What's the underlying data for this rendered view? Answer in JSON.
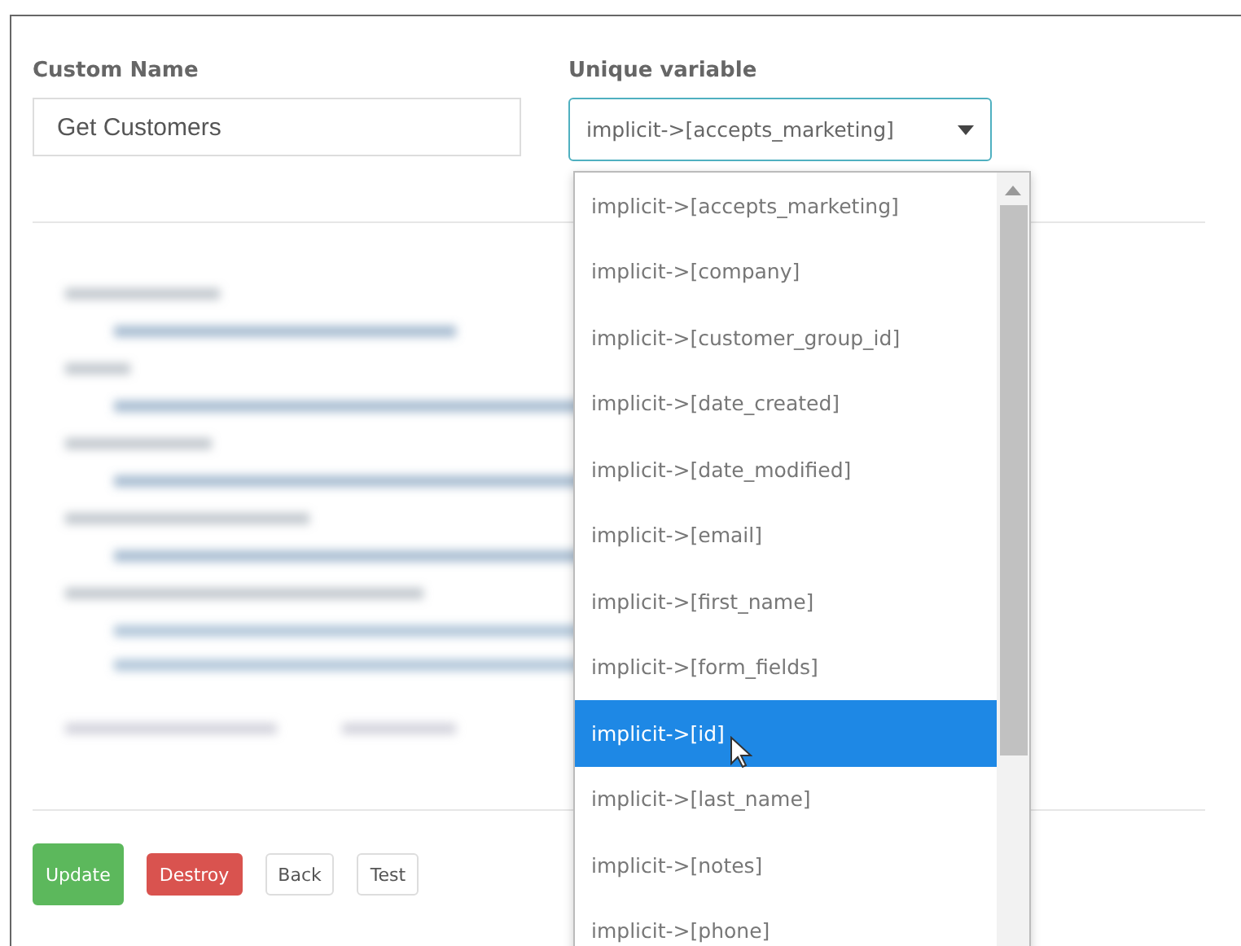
{
  "form": {
    "custom_name": {
      "label": "Custom Name",
      "value": "Get Customers"
    },
    "unique_variable": {
      "label": "Unique variable",
      "value": "implicit->[accepts_marketing]",
      "expanded": true,
      "options": [
        {
          "label": "implicit->[accepts_marketing]",
          "highlighted": false
        },
        {
          "label": "implicit->[company]",
          "highlighted": false
        },
        {
          "label": "implicit->[customer_group_id]",
          "highlighted": false
        },
        {
          "label": "implicit->[date_created]",
          "highlighted": false
        },
        {
          "label": "implicit->[date_modified]",
          "highlighted": false
        },
        {
          "label": "implicit->[email]",
          "highlighted": false
        },
        {
          "label": "implicit->[first_name]",
          "highlighted": false
        },
        {
          "label": "implicit->[form_fields]",
          "highlighted": false
        },
        {
          "label": "implicit->[id]",
          "highlighted": true
        },
        {
          "label": "implicit->[last_name]",
          "highlighted": false
        },
        {
          "label": "implicit->[notes]",
          "highlighted": false
        },
        {
          "label": "implicit->[phone]",
          "highlighted": false
        }
      ]
    }
  },
  "buttons": [
    {
      "label": "Update",
      "kind": "success"
    },
    {
      "label": "Destroy",
      "kind": "danger"
    },
    {
      "label": "Back",
      "kind": "plain"
    },
    {
      "label": "Test",
      "kind": "plain"
    }
  ]
}
